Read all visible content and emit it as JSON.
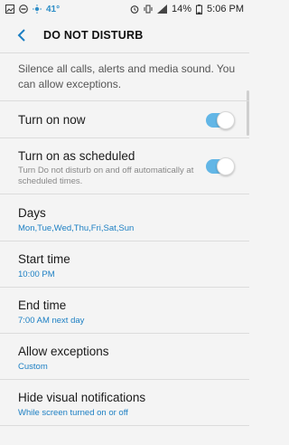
{
  "status_bar": {
    "temperature": "41°",
    "battery_percent": "14%",
    "time": "5:06 PM"
  },
  "header": {
    "title": "DO NOT DISTURB"
  },
  "description": "Silence all calls, alerts and media sound. You can allow exceptions.",
  "settings": {
    "turn_on_now": {
      "label": "Turn on now",
      "enabled": true
    },
    "turn_on_scheduled": {
      "label": "Turn on as scheduled",
      "description": "Turn Do not disturb on and off automatically at scheduled times.",
      "enabled": true
    },
    "days": {
      "label": "Days",
      "value": "Mon,Tue,Wed,Thu,Fri,Sat,Sun"
    },
    "start_time": {
      "label": "Start time",
      "value": "10:00 PM"
    },
    "end_time": {
      "label": "End time",
      "value": "7:00 AM next day"
    },
    "allow_exceptions": {
      "label": "Allow exceptions",
      "value": "Custom"
    },
    "hide_visual_notifications": {
      "label": "Hide visual notifications",
      "value": "While screen turned on or off"
    }
  },
  "colors": {
    "accent": "#1c7fc3",
    "toggle_on": "#62b6e6",
    "background": "#f4f4f4"
  }
}
